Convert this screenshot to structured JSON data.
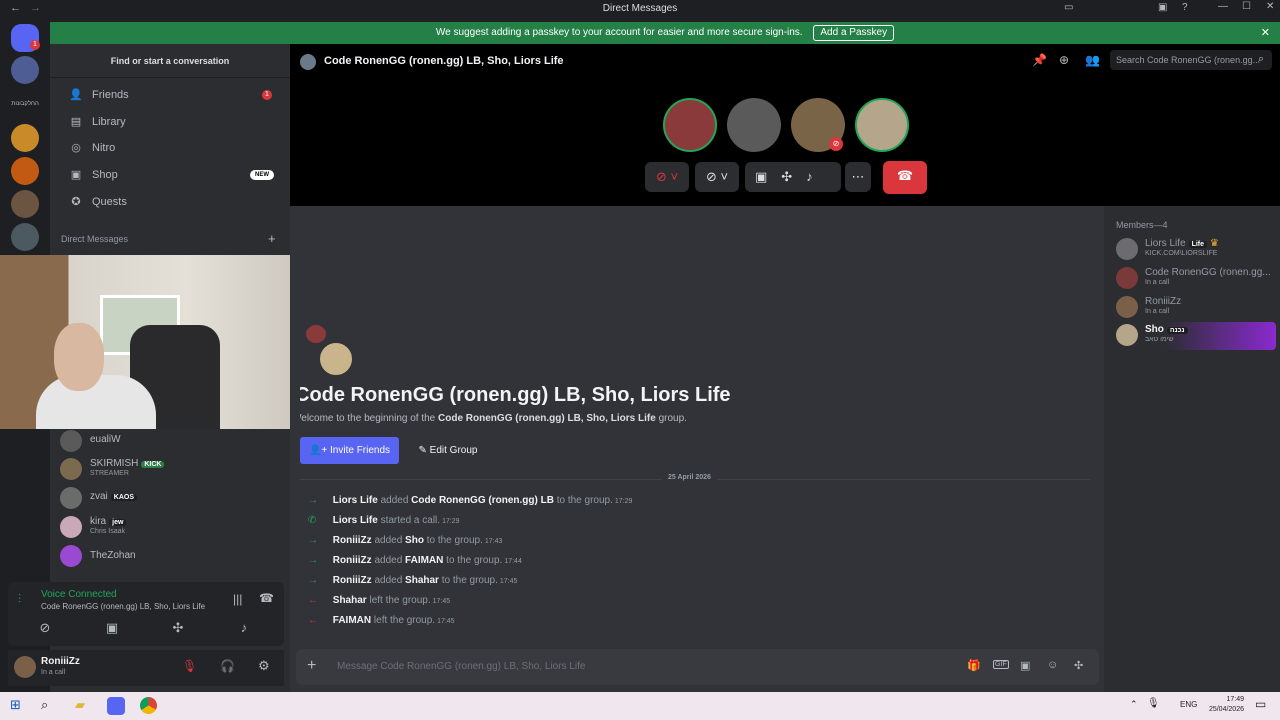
{
  "window": {
    "title": "Direct Messages"
  },
  "banner": {
    "text": "We suggest adding a passkey to your account for easier and more secure sign-ins.",
    "button": "Add a Passkey"
  },
  "servers": {
    "badge": "1",
    "folder_label": "החלקבונות"
  },
  "sidebar": {
    "search": "Find or start a conversation",
    "nav": [
      {
        "label": "Friends",
        "icon": "friends-icon",
        "badge": "1"
      },
      {
        "label": "Library",
        "icon": "library-icon"
      },
      {
        "label": "Nitro",
        "icon": "nitro-icon"
      },
      {
        "label": "Shop",
        "icon": "shop-icon",
        "badge": "NEW"
      },
      {
        "label": "Quests",
        "icon": "quests-icon"
      }
    ],
    "dm_header": "Direct Messages",
    "dms": [
      {
        "name": "eualiW",
        "sub": ""
      },
      {
        "name": "SKIRMISH",
        "tag": "KICK",
        "sub": "STREAMER"
      },
      {
        "name": "zvai",
        "tag": "KAOS",
        "sub": ""
      },
      {
        "name": "kira",
        "tag": "jew",
        "sub": "Chris Isaak"
      },
      {
        "name": "TheZohan",
        "sub": ""
      }
    ]
  },
  "voice": {
    "status": "Voice Connected",
    "channel": "Code RonenGG (ronen.gg) LB, Sho, Liors Life"
  },
  "user": {
    "name": "RoniiiZz",
    "status": "In a call"
  },
  "header": {
    "title": "Code RonenGG (ronen.gg) LB, Sho, Liors Life",
    "search_placeholder": "Search Code RonenGG (ronen.gg..."
  },
  "welcome": {
    "title": "Code RonenGG (ronen.gg) LB, Sho, Liors Life",
    "line_pre": "Welcome to the beginning of the ",
    "line_bold": "Code RonenGG (ronen.gg) LB, Sho, Liors Life",
    "line_post": " group.",
    "invite": "Invite Friends",
    "edit": "Edit Group"
  },
  "date_divider": "25 April 2026",
  "log": [
    {
      "kind": "join",
      "actor": "Liors Life",
      "verb": "added",
      "target": "Code RonenGG (ronen.gg) LB",
      "rest": "to the group.",
      "time": "17:29"
    },
    {
      "kind": "call",
      "actor": "Liors Life",
      "verb": "started a call.",
      "target": "",
      "rest": "",
      "time": "17:29"
    },
    {
      "kind": "join",
      "actor": "RoniiiZz",
      "verb": "added",
      "target": "Sho",
      "rest": "to the group.",
      "time": "17:43"
    },
    {
      "kind": "join",
      "actor": "RoniiiZz",
      "verb": "added",
      "target": "FAIMAN",
      "rest": "to the group.",
      "time": "17:44"
    },
    {
      "kind": "join",
      "actor": "RoniiiZz",
      "verb": "added",
      "target": "Shahar",
      "rest": "to the group.",
      "time": "17:45"
    },
    {
      "kind": "leave",
      "actor": "Shahar",
      "verb": "left the group.",
      "target": "",
      "rest": "",
      "time": "17:45"
    },
    {
      "kind": "leave",
      "actor": "FAIMAN",
      "verb": "left the group.",
      "target": "",
      "rest": "",
      "time": "17:45"
    }
  ],
  "composer": {
    "placeholder": "Message Code RonenGG (ronen.gg) LB, Sho, Liors Life"
  },
  "members": {
    "header": "Members—4",
    "list": [
      {
        "name": "Liors Life",
        "tag": "Life",
        "sub": "KICK.COM\\LIORSLIFE"
      },
      {
        "name": "Code RonenGG (ronen.gg...",
        "sub": "In a call"
      },
      {
        "name": "RoniiiZz",
        "sub": "In a call"
      },
      {
        "name": "Sho",
        "tag": "נכנה",
        "sub": "שימו טאב"
      }
    ]
  },
  "taskbar": {
    "lang": "ENG",
    "time": "17:49",
    "date": "25/04/2026"
  },
  "colors": {
    "accent": "#5865f2",
    "online": "#23a559",
    "danger": "#da373c",
    "banner": "#248046"
  }
}
